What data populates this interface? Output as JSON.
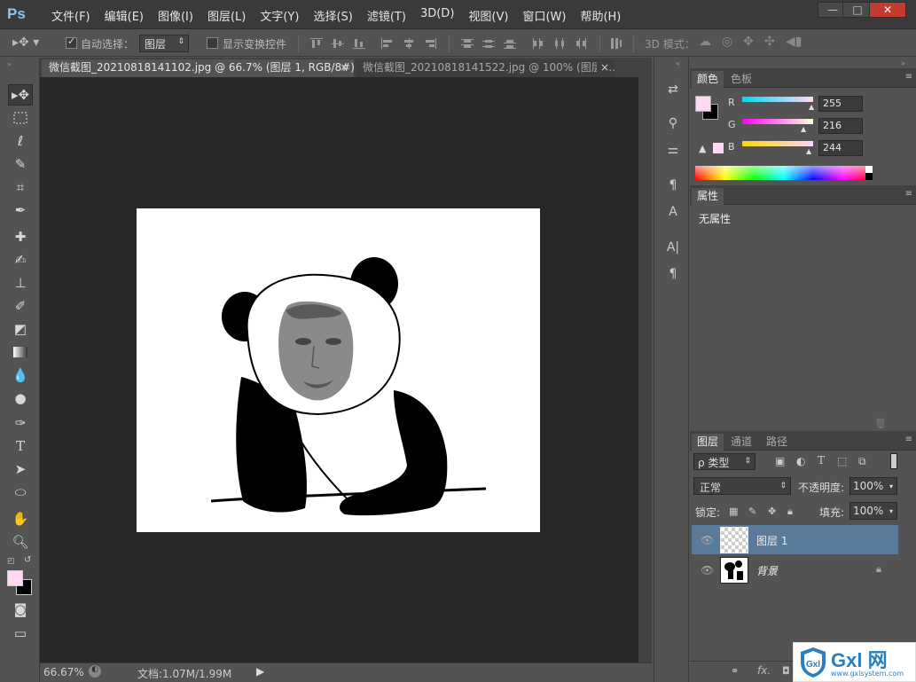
{
  "app": {
    "logo": "Ps"
  },
  "menu": [
    "文件(F)",
    "编辑(E)",
    "图像(I)",
    "图层(L)",
    "文字(Y)",
    "选择(S)",
    "滤镜(T)",
    "3D(D)",
    "视图(V)",
    "窗口(W)",
    "帮助(H)"
  ],
  "window_controls": {
    "minimize": "—",
    "restore": "□",
    "close": "✕"
  },
  "options": {
    "auto_select_label": "自动选择：",
    "auto_select_value": "图层",
    "show_transform_label": "显示变换控件",
    "mode3d_label": "3D 模式："
  },
  "tabs": [
    {
      "label": "微信截图_20210818141102.jpg @ 66.7% (图层 1, RGB/8#) *",
      "close": "×"
    },
    {
      "label": "微信截图_20210818141522.jpg @ 100% (图层 ...",
      "close": "×"
    }
  ],
  "status": {
    "zoom": "66.67%",
    "doc": "文档:1.07M/1.99M"
  },
  "color_panel": {
    "tabs": [
      "颜色",
      "色板"
    ],
    "r_label": "R",
    "r": "255",
    "g_label": "G",
    "g": "216",
    "b_label": "B",
    "b": "244",
    "foreground": "#ffd8f4",
    "background": "#000000"
  },
  "properties": {
    "tab": "属性",
    "text": "无属性"
  },
  "layers_panel": {
    "tabs": [
      "图层",
      "通道",
      "路径"
    ],
    "filter_label": "ρ 类型",
    "blend_mode": "正常",
    "opacity_label": "不透明度:",
    "opacity": "100%",
    "lock_label": "锁定:",
    "fill_label": "填充:",
    "fill": "100%",
    "layers": [
      {
        "name": "图层 1"
      },
      {
        "name": "背景"
      }
    ]
  },
  "watermark": {
    "text": "Gxl 网",
    "url": "www.gxlsystem.com"
  }
}
